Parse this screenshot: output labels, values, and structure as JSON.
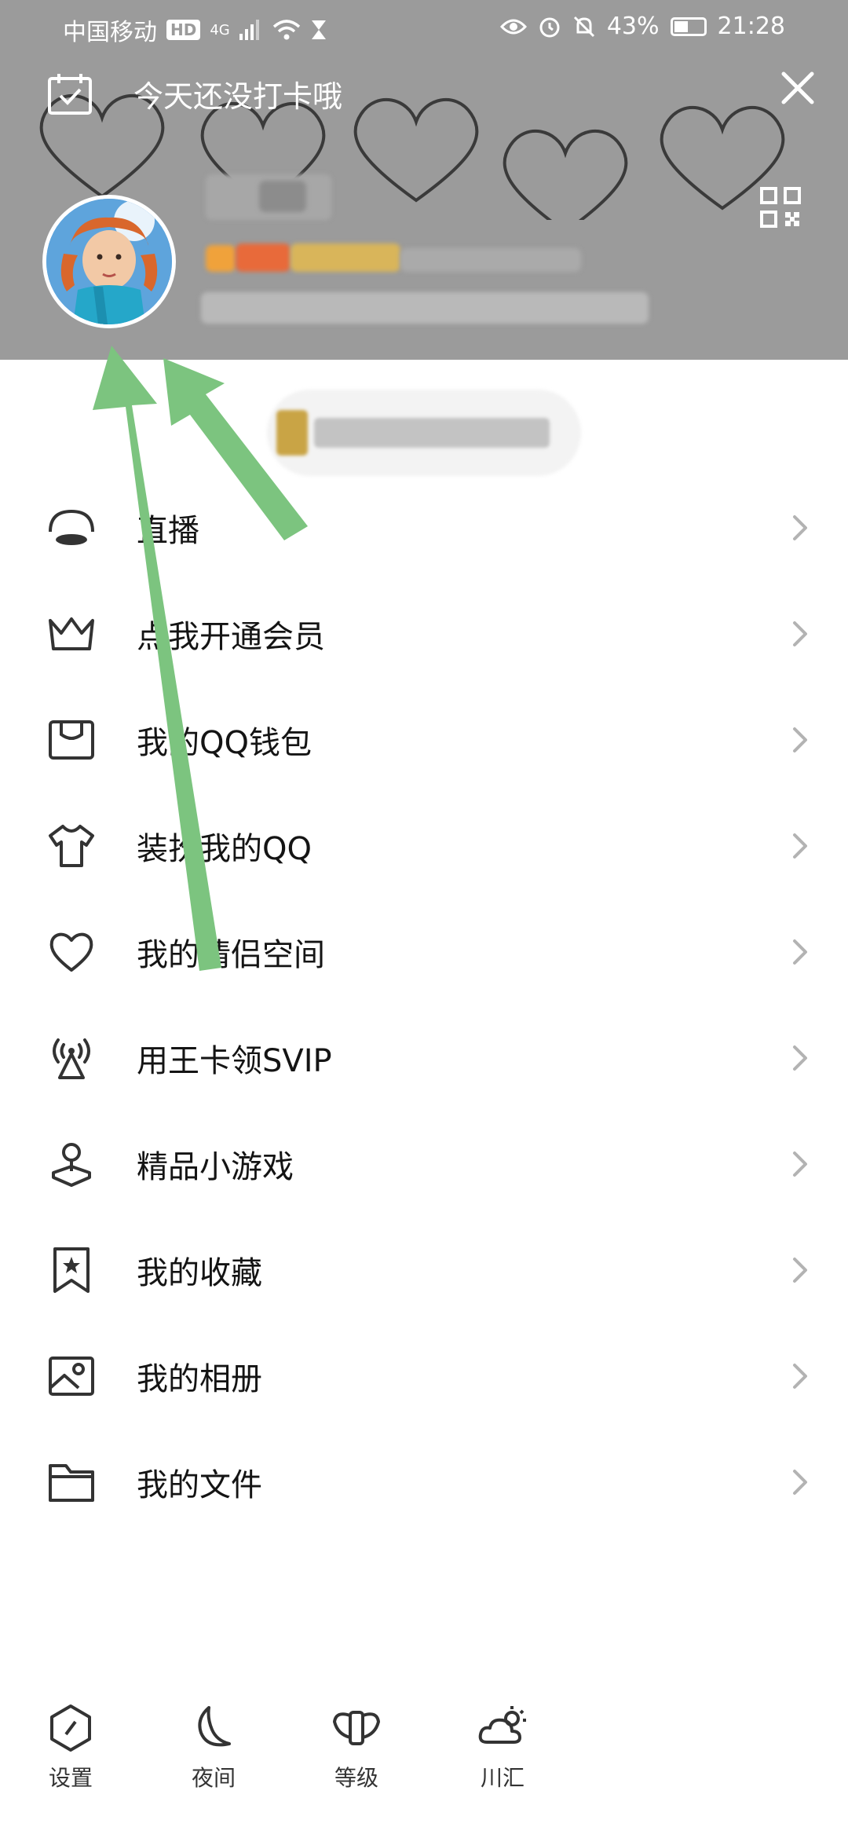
{
  "status_bar": {
    "carrier": "中国移动",
    "hd": "HD",
    "network": "4G",
    "battery_text": "43%",
    "battery_level": 0.43,
    "time": "21:28"
  },
  "header": {
    "checkin_text": "今天还没打卡哦",
    "background_color": "#9b9b9b"
  },
  "menu": {
    "items": [
      {
        "label": "直播",
        "icon": "live-icon"
      },
      {
        "label": "点我开通会员",
        "icon": "crown-icon"
      },
      {
        "label": "我的QQ钱包",
        "icon": "wallet-icon"
      },
      {
        "label": "装扮我的QQ",
        "icon": "tshirt-icon"
      },
      {
        "label": "我的情侣空间",
        "icon": "heart-icon"
      },
      {
        "label": "用王卡领SVIP",
        "icon": "signal-tower-icon"
      },
      {
        "label": "精品小游戏",
        "icon": "joystick-icon"
      },
      {
        "label": "我的收藏",
        "icon": "bookmark-star-icon"
      },
      {
        "label": "我的相册",
        "icon": "photo-album-icon"
      },
      {
        "label": "我的文件",
        "icon": "folder-icon"
      }
    ]
  },
  "bottom_bar": {
    "items": [
      {
        "label": "设置",
        "icon": "settings-icon"
      },
      {
        "label": "夜间",
        "icon": "moon-icon"
      },
      {
        "label": "等级",
        "icon": "wings-icon"
      },
      {
        "label": "川汇",
        "icon": "weather-cloud-sun-icon"
      }
    ]
  },
  "colors": {
    "annotation_arrow": "#7cc47f",
    "chevron": "#b3b3b3"
  }
}
